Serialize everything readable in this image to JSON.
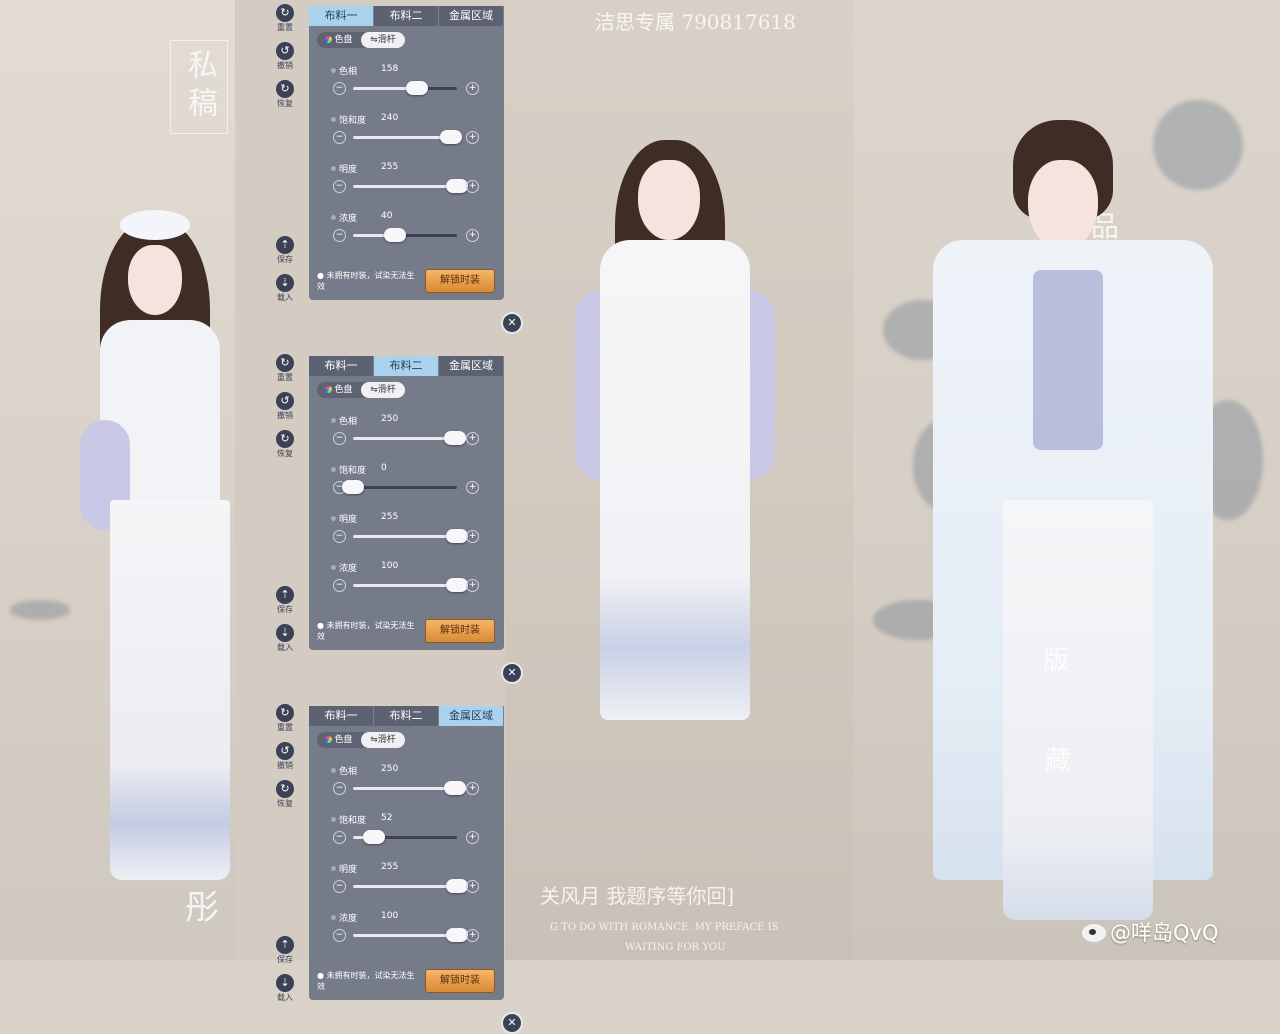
{
  "watermarks": {
    "top_center": "洁思专属  790817618",
    "left_seal": "私稿",
    "right_seal": "蕾品",
    "right_vertical_1": "版",
    "right_vertical_2": "藏",
    "bottom_center": "关风月 我题序等你回]",
    "bottom_english_1": "G TO DO WITH ROMANCE. MY PREFACE IS",
    "bottom_english_2": "WAITING FOR YOU",
    "left_bottom": "彤"
  },
  "weibo_handle": "@咩岛QvQ",
  "side_tool_labels": {
    "reset": "重置",
    "undo": "撤销",
    "redo": "恢复",
    "save": "保存",
    "load": "载入"
  },
  "tabs": [
    "布料一",
    "布料二",
    "金属区域"
  ],
  "modes": {
    "palette": "色盘",
    "slider": "滑杆"
  },
  "slider_labels": {
    "hue": "色相",
    "saturation": "饱和度",
    "brightness": "明度",
    "density": "浓度"
  },
  "notice_text": "未拥有时装，试染无法生效",
  "unlock_label": "解锁时装",
  "panels": [
    {
      "active_tab": 0,
      "hue": 158,
      "saturation": 240,
      "brightness": 255,
      "density": 40,
      "hue_frac": 0.62,
      "saturation_frac": 0.94,
      "brightness_frac": 1.0,
      "density_frac": 0.4
    },
    {
      "active_tab": 1,
      "hue": 250,
      "saturation": 0,
      "brightness": 255,
      "density": 100,
      "hue_frac": 0.98,
      "saturation_frac": 0.0,
      "brightness_frac": 1.0,
      "density_frac": 1.0
    },
    {
      "active_tab": 2,
      "hue": 250,
      "saturation": 52,
      "brightness": 255,
      "density": 100,
      "hue_frac": 0.98,
      "saturation_frac": 0.2,
      "brightness_frac": 1.0,
      "density_frac": 1.0
    }
  ],
  "colors": {
    "panel_bg": "#767b8a",
    "tab_active": "#a8d2ee",
    "unlock_button": "#e9a14e"
  }
}
